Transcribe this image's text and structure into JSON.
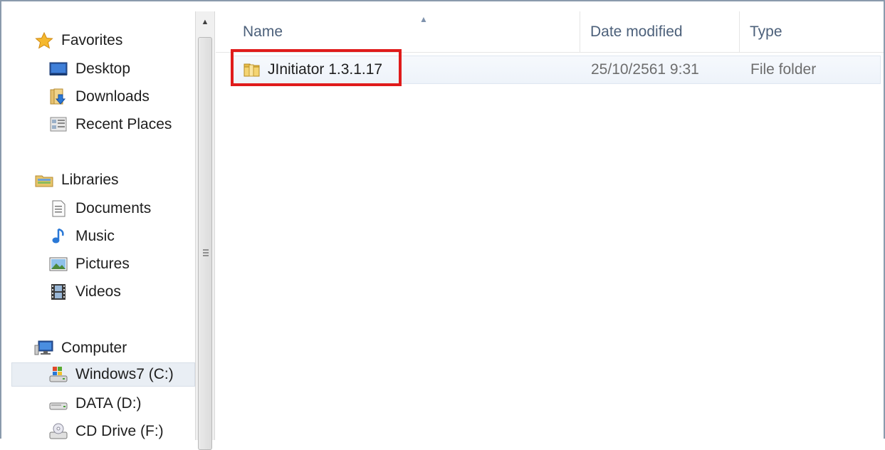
{
  "navigation": {
    "groups": {
      "favorites": {
        "label": "Favorites",
        "icon": "star-icon"
      },
      "libraries": {
        "label": "Libraries",
        "icon": "libraries-icon"
      },
      "computer": {
        "label": "Computer",
        "icon": "computer-icon"
      }
    },
    "favorites_items": [
      {
        "label": "Desktop",
        "icon": "desktop-icon"
      },
      {
        "label": "Downloads",
        "icon": "downloads-icon"
      },
      {
        "label": "Recent Places",
        "icon": "recent-places-icon"
      }
    ],
    "libraries_items": [
      {
        "label": "Documents",
        "icon": "documents-icon"
      },
      {
        "label": "Music",
        "icon": "music-icon"
      },
      {
        "label": "Pictures",
        "icon": "pictures-icon"
      },
      {
        "label": "Videos",
        "icon": "videos-icon"
      }
    ],
    "computer_items": [
      {
        "label": "Windows7 (C:)",
        "icon": "windows-drive-icon",
        "selected": true
      },
      {
        "label": "DATA (D:)",
        "icon": "drive-icon"
      },
      {
        "label": "CD Drive (F:)",
        "icon": "cd-drive-icon"
      }
    ]
  },
  "columns": {
    "name": "Name",
    "date_modified": "Date modified",
    "type": "Type"
  },
  "files": [
    {
      "name": "JInitiator 1.3.1.17",
      "date_modified": "25/10/2561 9:31",
      "type": "File folder",
      "icon": "folder-icon"
    }
  ],
  "colors": {
    "highlight": "#e01b1b",
    "header_text": "#4c607a",
    "row_selection": "#eef3fa"
  }
}
